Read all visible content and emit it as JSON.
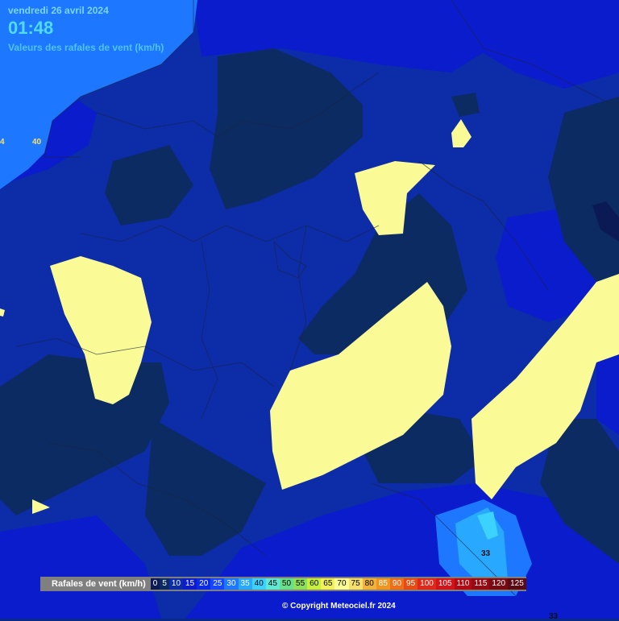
{
  "header": {
    "date": "vendredi 26 avril 2024",
    "time": "01:48",
    "subtitle": "Valeurs des rafales de vent (km/h)"
  },
  "value_labels": [
    "4",
    "40",
    "33",
    "33"
  ],
  "legend": {
    "title": "Rafales de vent (km/h)",
    "items": [
      {
        "value": "0",
        "color": "#0b1a55",
        "text_color": "#ffffff"
      },
      {
        "value": "5",
        "color": "#0c2b63",
        "text_color": "#ffffff"
      },
      {
        "value": "10",
        "color": "#0c2ca8",
        "text_color": "#ffffff"
      },
      {
        "value": "15",
        "color": "#0a1ccc",
        "text_color": "#ffffff"
      },
      {
        "value": "20",
        "color": "#0a2ae6",
        "text_color": "#ffffff"
      },
      {
        "value": "25",
        "color": "#1647ff",
        "text_color": "#ffffff"
      },
      {
        "value": "30",
        "color": "#1e78ff",
        "text_color": "#ffffff"
      },
      {
        "value": "35",
        "color": "#28a8ff",
        "text_color": "#ffffff"
      },
      {
        "value": "40",
        "color": "#3cd2ff",
        "text_color": "#000000"
      },
      {
        "value": "45",
        "color": "#5fe8d6",
        "text_color": "#000000"
      },
      {
        "value": "50",
        "color": "#66e08a",
        "text_color": "#000000"
      },
      {
        "value": "55",
        "color": "#8ee05a",
        "text_color": "#000000"
      },
      {
        "value": "60",
        "color": "#c6f03c",
        "text_color": "#000000"
      },
      {
        "value": "65",
        "color": "#f0f05a",
        "text_color": "#000000"
      },
      {
        "value": "70",
        "color": "#fafa96",
        "text_color": "#000000"
      },
      {
        "value": "75",
        "color": "#f5e06e",
        "text_color": "#000000"
      },
      {
        "value": "80",
        "color": "#f0b43c",
        "text_color": "#000000"
      },
      {
        "value": "85",
        "color": "#f0961e",
        "text_color": "#ffffff"
      },
      {
        "value": "90",
        "color": "#ee6e1a",
        "text_color": "#ffffff"
      },
      {
        "value": "95",
        "color": "#e84a14",
        "text_color": "#ffffff"
      },
      {
        "value": "100",
        "color": "#e0281a",
        "text_color": "#ffffff"
      },
      {
        "value": "105",
        "color": "#d0141a",
        "text_color": "#ffffff"
      },
      {
        "value": "110",
        "color": "#b40a14",
        "text_color": "#ffffff"
      },
      {
        "value": "115",
        "color": "#960a14",
        "text_color": "#ffffff"
      },
      {
        "value": "120",
        "color": "#780a14",
        "text_color": "#ffffff"
      },
      {
        "value": "125",
        "color": "#5a0a14",
        "text_color": "#ffffff"
      }
    ]
  },
  "copyright": "© Copyright Meteociel.fr 2024",
  "colors": {
    "sea": "#1e78ff",
    "calm_dark": "#0c2b63",
    "base_blue": "#0c2ca8",
    "bright_blue": "#0a1ccc",
    "gust_zone": "#fafa96"
  }
}
